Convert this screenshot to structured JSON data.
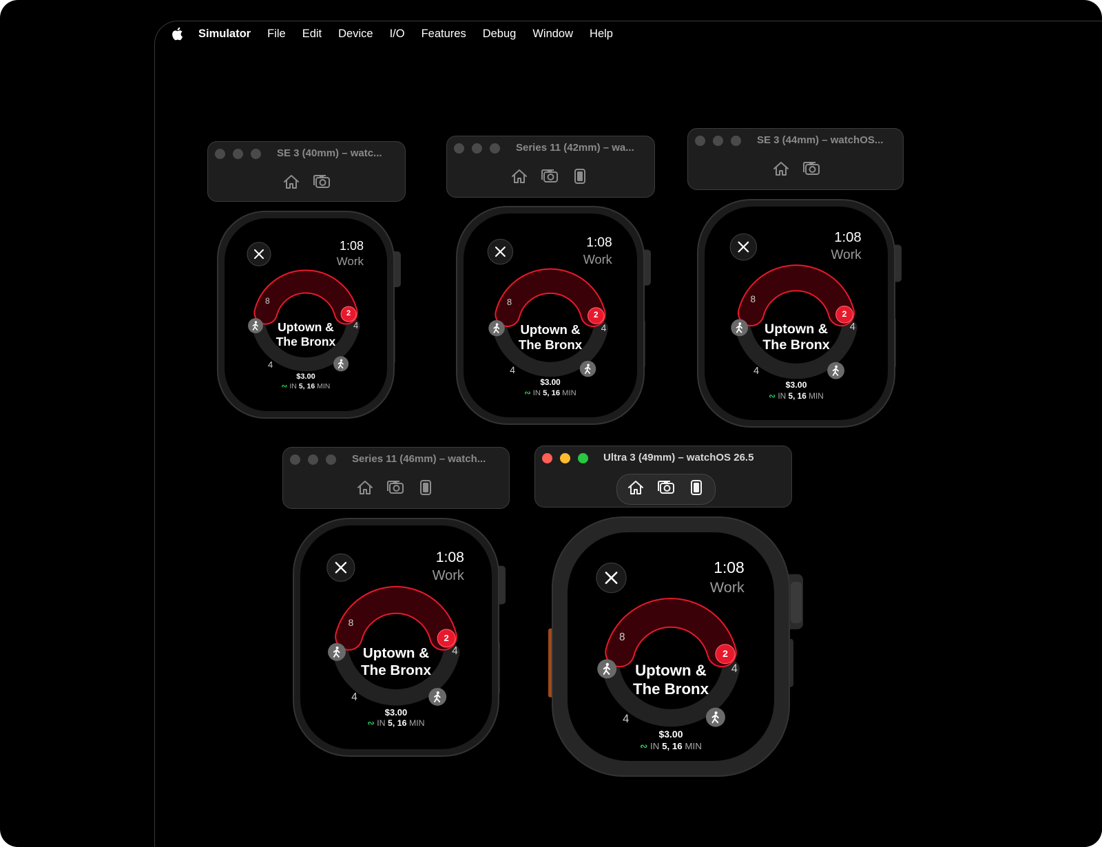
{
  "menubar": {
    "app_name": "Simulator",
    "items": [
      "File",
      "Edit",
      "Device",
      "I/O",
      "Features",
      "Debug",
      "Window",
      "Help"
    ]
  },
  "windows": [
    {
      "title": "SE 3 (40mm) – watc...",
      "tools": [
        "home-icon",
        "screenshot-icon"
      ]
    },
    {
      "title": "Series 11 (42mm) – wa...",
      "tools": [
        "home-icon",
        "screenshot-icon",
        "rotate-icon"
      ]
    },
    {
      "title": "SE 3 (44mm) – watchOS...",
      "tools": [
        "home-icon",
        "screenshot-icon"
      ]
    },
    {
      "title": "Series 11 (46mm) – watch...",
      "tools": [
        "home-icon",
        "screenshot-icon",
        "rotate-icon"
      ]
    },
    {
      "title": "Ultra 3 (49mm) – watchOS 26.5",
      "tools": [
        "home-icon",
        "screenshot-icon",
        "rotate-icon"
      ],
      "active": true
    }
  ],
  "watch_app": {
    "time": "1:08",
    "mode": "Work",
    "station_line1": "Uptown &",
    "station_line2": "The Bronx",
    "fare": "$3.00",
    "eta_prefix": "IN",
    "eta_values": "5, 16",
    "eta_unit": "MIN",
    "top_left_count": "8",
    "top_right_count": "2",
    "right_count": "4",
    "bottom_left_count": "4",
    "close_icon": "close-icon",
    "walk_icon": "walk-icon",
    "signal_icon": "live-signal-icon",
    "accent_color": "#e8192c",
    "arc_fill": "#3a0208",
    "eta_icon_color": "#30d158"
  }
}
